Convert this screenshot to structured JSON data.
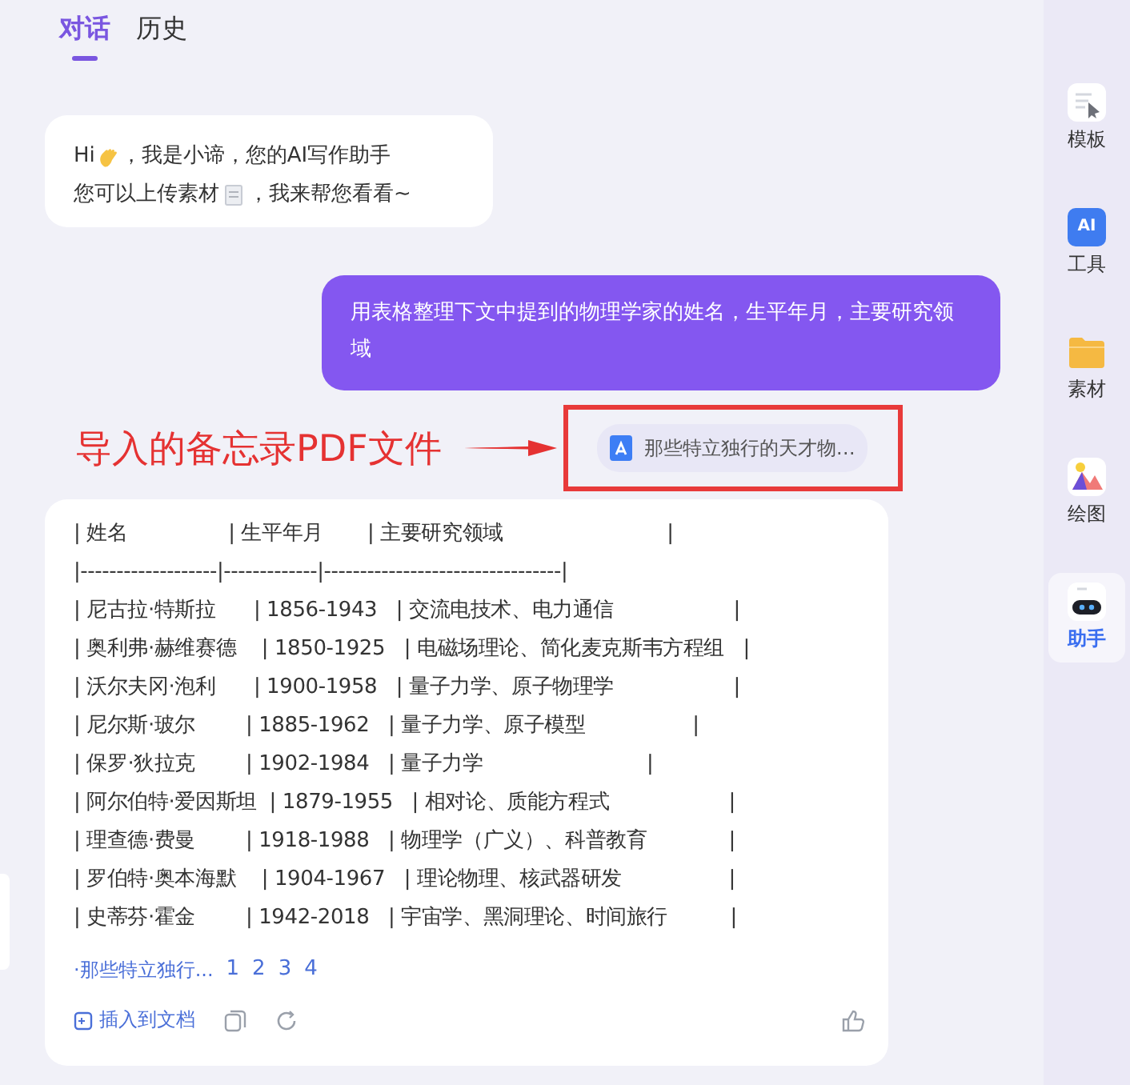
{
  "tabs": [
    {
      "label": "对话",
      "selected": true
    },
    {
      "label": "历史",
      "selected": false
    }
  ],
  "messages": [
    {
      "kind": "bot",
      "lines": [
        "Hi",
        "，我是小谛，您的AI写作助手",
        "您可以上传素材",
        "，我来帮您看看~"
      ]
    },
    {
      "kind": "user",
      "text": "用表格整理下文中提到的物理学家的姓名，生平年月，主要研究领域"
    },
    {
      "kind": "file",
      "name": "那些特立独行的天才物…"
    }
  ],
  "annotation": {
    "text": "导入的备忘录PDF文件"
  },
  "answer": {
    "lines": [
      "| 姓名                | 生平年月       | 主要研究领域                          |",
      "|-------------------|-------------|---------------------------------|",
      "| 尼古拉·特斯拉      | 1856-1943   | 交流电技术、电力通信                   |",
      "| 奥利弗·赫维赛德    | 1850-1925   | 电磁场理论、简化麦克斯韦方程组   |",
      "| 沃尔夫冈·泡利      | 1900-1958   | 量子力学、原子物理学                   |",
      "| 尼尔斯·玻尔        | 1885-1962   | 量子力学、原子模型                 |",
      "| 保罗·狄拉克        | 1902-1984   | 量子力学                          |",
      "| 阿尔伯特·爱因斯坦  | 1879-1955   | 相对论、质能方程式                   |",
      "| 理查德·费曼        | 1918-1988   | 物理学（广义）、科普教育             |",
      "| 罗伯特·奥本海默    | 1904-1967   | 理论物理、核武器研发                 |",
      "| 史蒂芬·霍金        | 1942-2018   | 宇宙学、黑洞理论、时间旅行          |"
    ],
    "source": "·那些特立独行...",
    "pages": [
      "1",
      "2",
      "3",
      "4"
    ],
    "insert": "插入到文档"
  },
  "sidebar": [
    {
      "kind": "template",
      "label": "模板",
      "selected": false
    },
    {
      "kind": "ai",
      "label": "工具",
      "selected": false,
      "badge": "AI"
    },
    {
      "kind": "folder",
      "label": "素材",
      "selected": false
    },
    {
      "kind": "image",
      "label": "绘图",
      "selected": false
    },
    {
      "kind": "robot",
      "label": "助手",
      "selected": true
    }
  ]
}
